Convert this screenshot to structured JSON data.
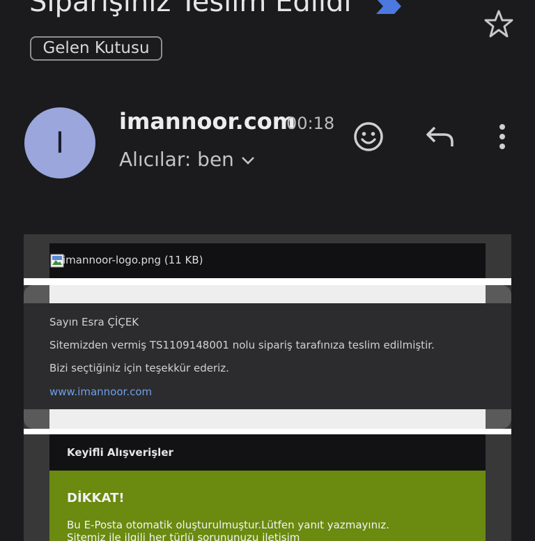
{
  "email": {
    "subject": "Siparişiniz Teslim Edildi",
    "label_chip": "Gelen Kutusu",
    "avatar_letter": "I",
    "sender": "imannoor.com",
    "time": "00:18",
    "recipients": "Alıcılar: ben"
  },
  "icons": {
    "importance": "importance-marker-icon",
    "star": "star-icon",
    "emoji": "emoji-react-icon",
    "reply": "reply-icon",
    "more": "more-vertical-icon",
    "chevron": "chevron-down-icon",
    "broken_image": "broken-image-icon"
  },
  "colors": {
    "importance_marker": "#4c78e0",
    "avatar_bg": "#9aa6dc",
    "link": "#6e9fe8",
    "warning_bg": "#6a8a10"
  },
  "body": {
    "logo_alt": "imannoor-logo.png (11 KB)",
    "greeting": "Sayın Esra ÇİÇEK",
    "message": "Sitemizden vermiş TS1109148001 nolu sipariş tarafınıza teslim edilmiştir.",
    "thanks": "Bizi seçtiğiniz için teşekkür ederiz.",
    "link": "www.imannoor.com",
    "heading": "Keyifli Alışverişler",
    "warning_title": "DİKKAT!",
    "warning_line1": "Bu E-Posta otomatik oluşturulmuştur.Lütfen yanıt yazmayınız.",
    "warning_line2": "Sitemiz ile ilgili her türlü sorununuzu iletişim"
  }
}
